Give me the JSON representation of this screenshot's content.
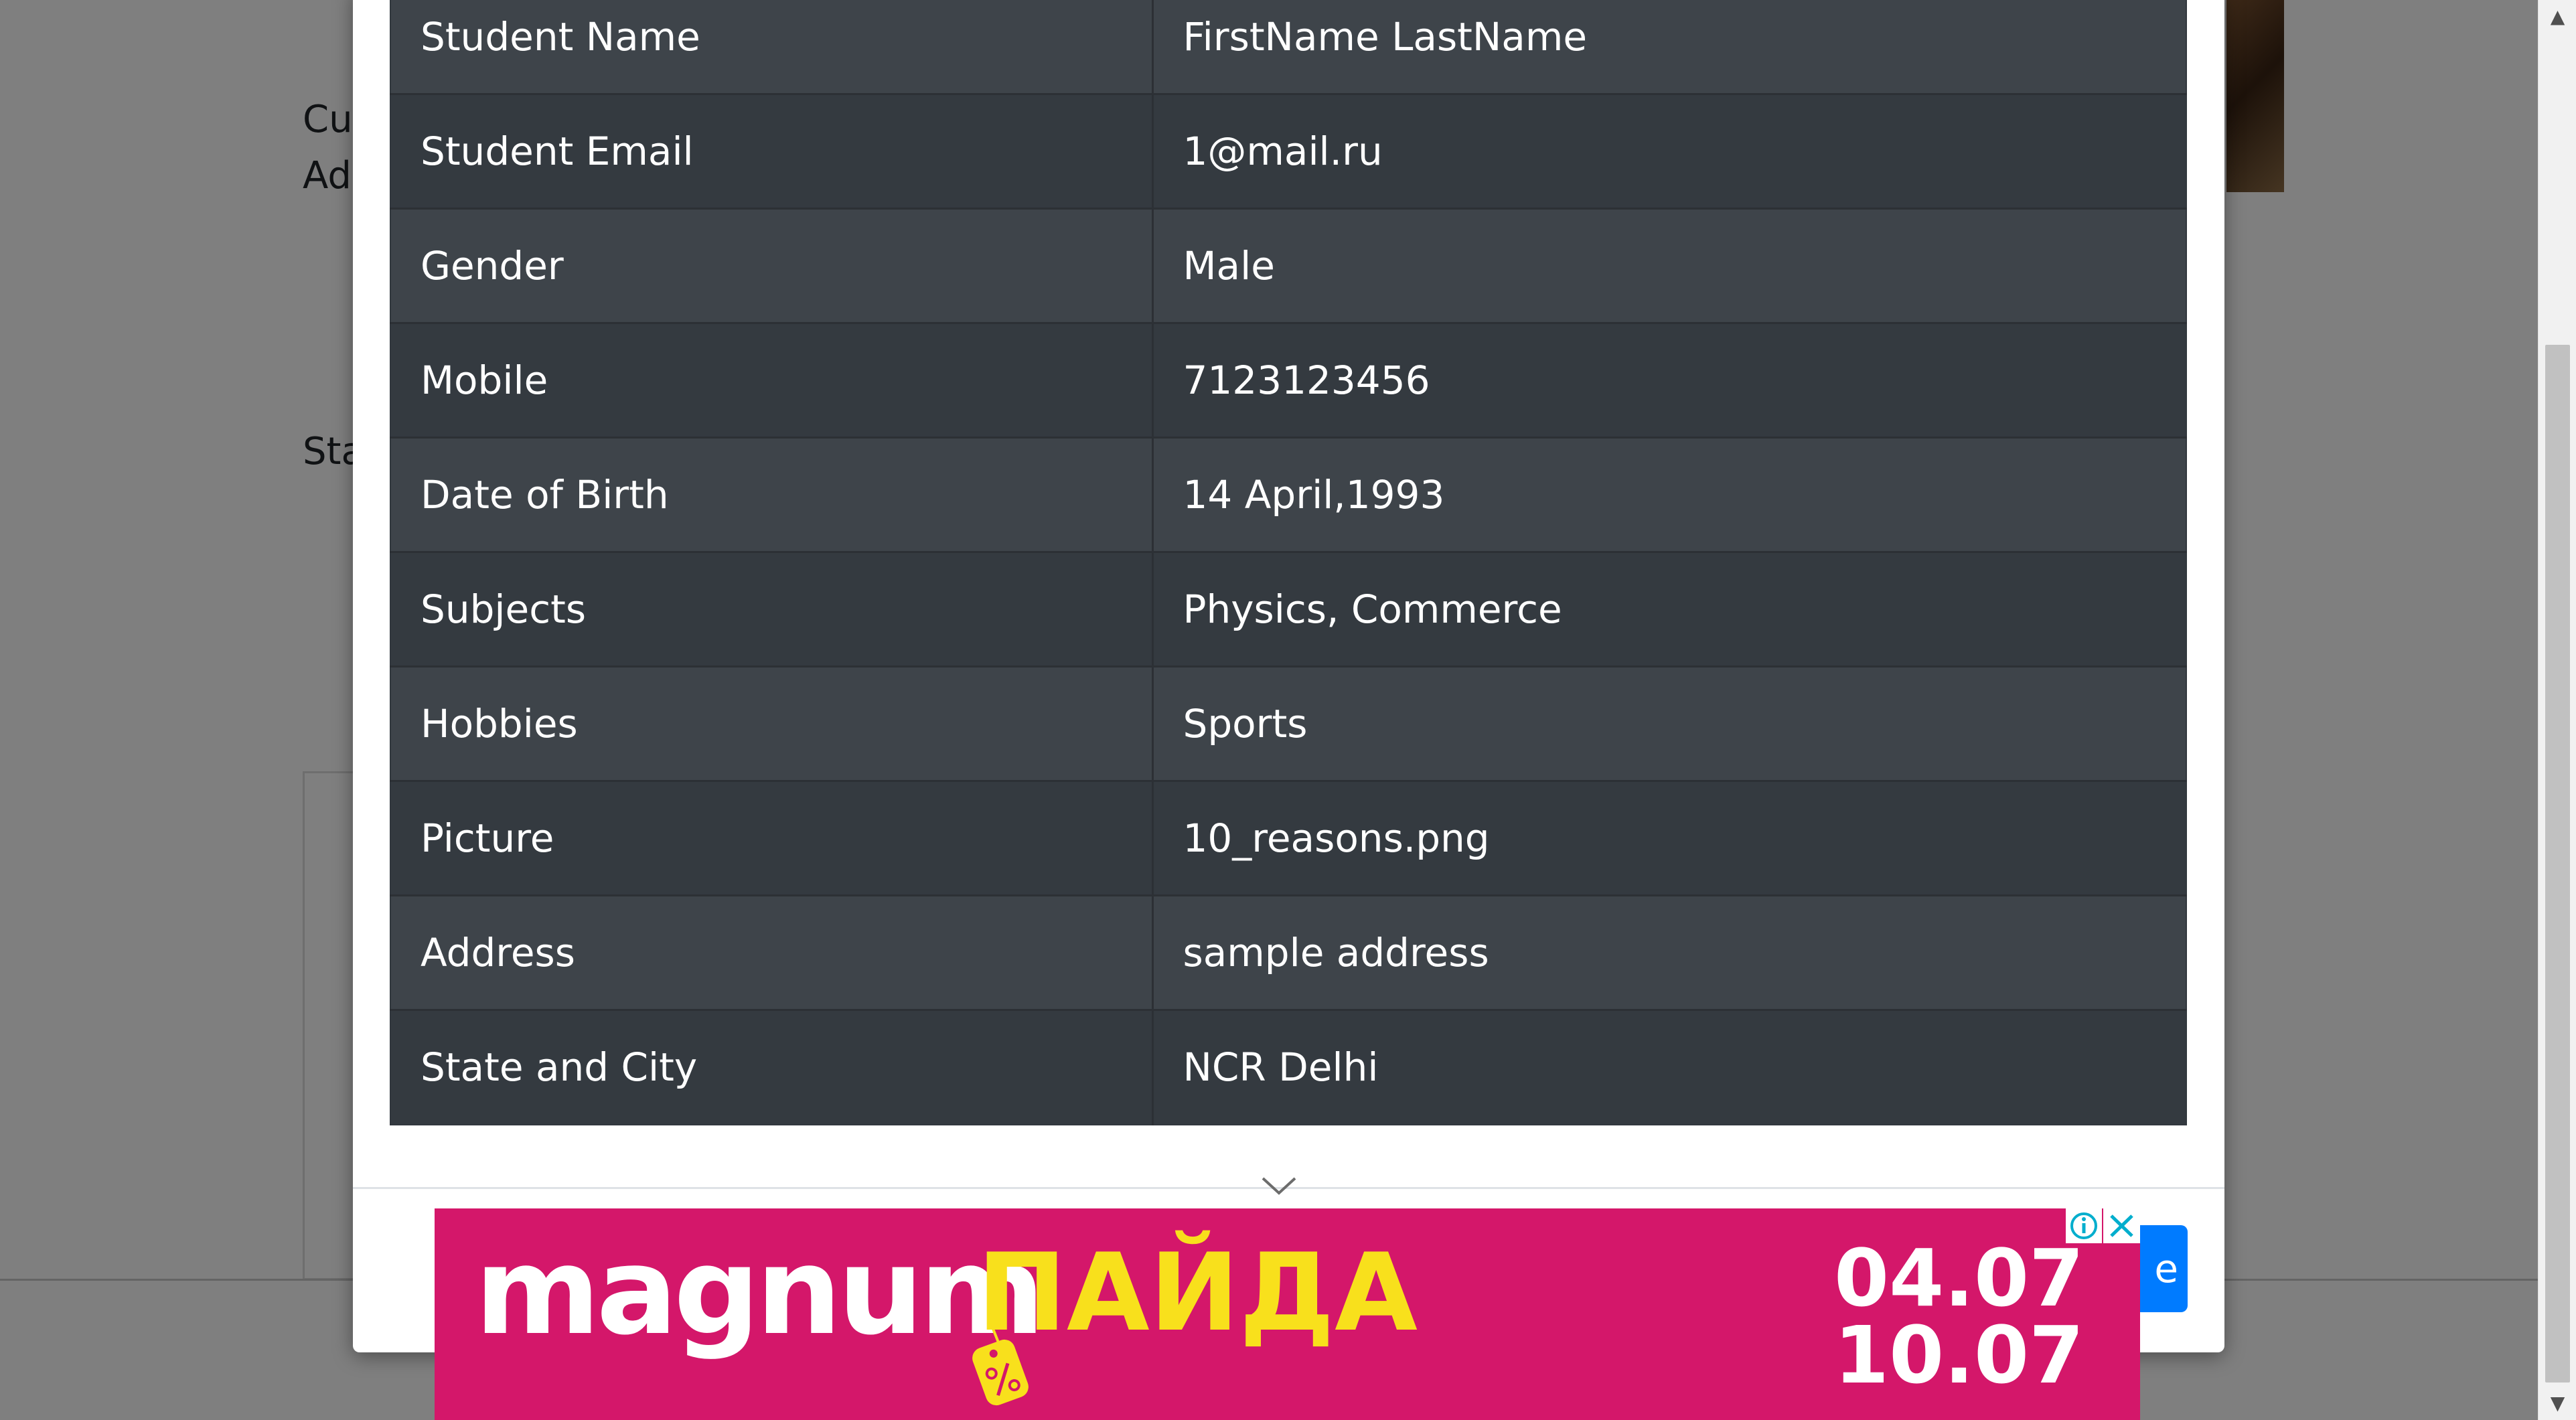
{
  "background": {
    "labels": [
      "Cur",
      "Add",
      "Sta"
    ]
  },
  "modal": {
    "rows": [
      {
        "label": "Student Name",
        "value": "FirstName LastName"
      },
      {
        "label": "Student Email",
        "value": "1@mail.ru"
      },
      {
        "label": "Gender",
        "value": "Male"
      },
      {
        "label": "Mobile",
        "value": "7123123456"
      },
      {
        "label": "Date of Birth",
        "value": "14 April,1993"
      },
      {
        "label": "Subjects",
        "value": "Physics, Commerce"
      },
      {
        "label": "Hobbies",
        "value": "Sports"
      },
      {
        "label": "Picture",
        "value": "10_reasons.png"
      },
      {
        "label": "Address",
        "value": "sample address"
      },
      {
        "label": "State and City",
        "value": "NCR Delhi"
      }
    ],
    "close_button_label": "e"
  },
  "ad": {
    "brand": "magnum",
    "slogan": "ПАЙДА",
    "date_start": "04.07",
    "date_end": "10.07",
    "background_color": "#d4176a",
    "accent_color": "#f8e01c"
  },
  "icons": [
    "chevron-down-icon",
    "info-icon",
    "close-icon",
    "price-tag-icon",
    "scroll-up-icon",
    "scroll-down-icon"
  ]
}
